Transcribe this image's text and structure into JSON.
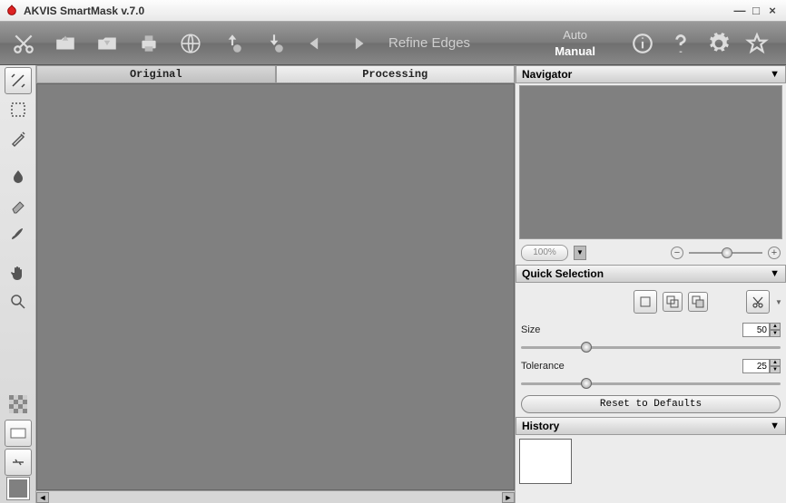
{
  "window": {
    "title": "AKVIS SmartMask v.7.0"
  },
  "toolbar": {
    "refine": "Refine Edges",
    "mode_auto": "Auto",
    "mode_manual": "Manual",
    "active_mode": "Manual"
  },
  "tabs": {
    "original": "Original",
    "processing": "Processing",
    "active": "Processing"
  },
  "panels": {
    "navigator": {
      "title": "Navigator",
      "zoom": "100%"
    },
    "quick_selection": {
      "title": "Quick Selection",
      "size_label": "Size",
      "size_value": 50,
      "tolerance_label": "Tolerance",
      "tolerance_value": 25,
      "reset": "Reset to Defaults"
    },
    "history": {
      "title": "History"
    }
  },
  "colors": {
    "swatch": "#808080"
  }
}
